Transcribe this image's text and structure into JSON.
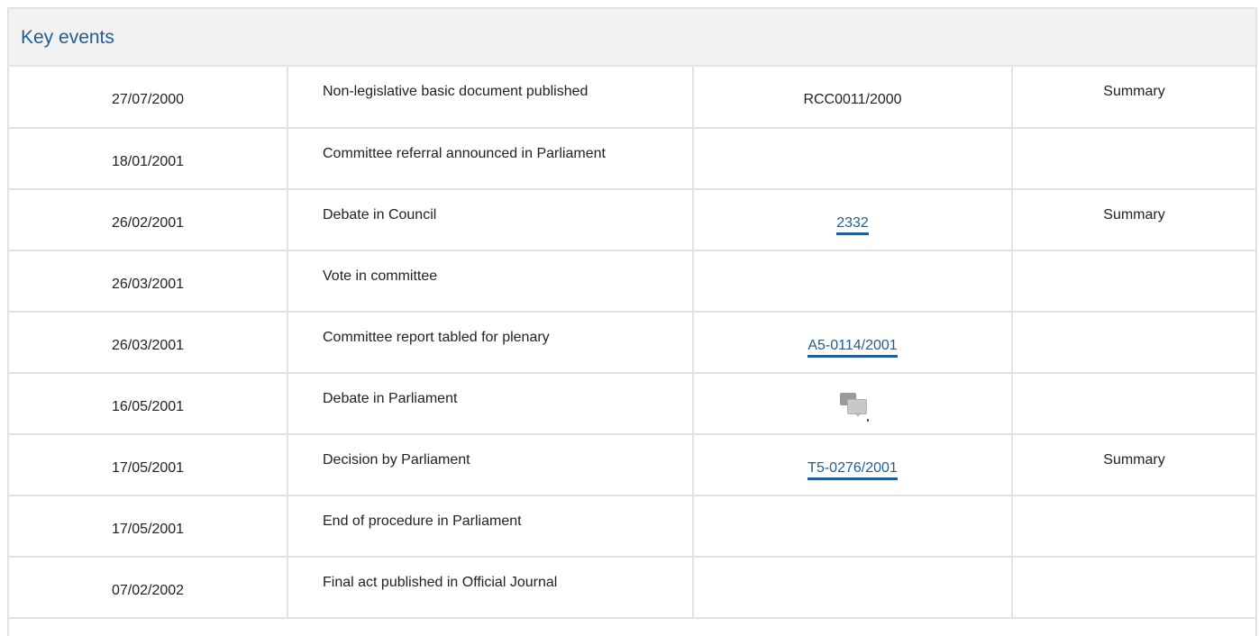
{
  "panel": {
    "title": "Key events"
  },
  "events": [
    {
      "date": "27/07/2000",
      "event": "Non-legislative basic document published",
      "ref": "RCC0011/2000",
      "ref_link": false,
      "summary": "Summary"
    },
    {
      "date": "18/01/2001",
      "event": "Committee referral announced in Parliament",
      "ref": "",
      "ref_link": false,
      "summary": ""
    },
    {
      "date": "26/02/2001",
      "event": "Debate in Council",
      "ref": "2332",
      "ref_link": true,
      "summary": "Summary"
    },
    {
      "date": "26/03/2001",
      "event": "Vote in committee",
      "ref": "",
      "ref_link": false,
      "summary": ""
    },
    {
      "date": "26/03/2001",
      "event": "Committee report tabled for plenary",
      "ref": "A5-0114/2001",
      "ref_link": true,
      "summary": ""
    },
    {
      "date": "16/05/2001",
      "event": "Debate in Parliament",
      "ref_icon": "debate-speech-bubbles-icon",
      "summary": ""
    },
    {
      "date": "17/05/2001",
      "event": "Decision by Parliament",
      "ref": "T5-0276/2001",
      "ref_link": true,
      "summary": "Summary"
    },
    {
      "date": "17/05/2001",
      "event": "End of procedure in Parliament",
      "ref": "",
      "ref_link": false,
      "summary": ""
    },
    {
      "date": "07/02/2002",
      "event": "Final act published in Official Journal",
      "ref": "",
      "ref_link": false,
      "summary": ""
    }
  ],
  "colors": {
    "title": "#1e5e94",
    "link": "#1e5e94",
    "header_bg": "#f2f2f2",
    "border": "#e3e3e3"
  }
}
